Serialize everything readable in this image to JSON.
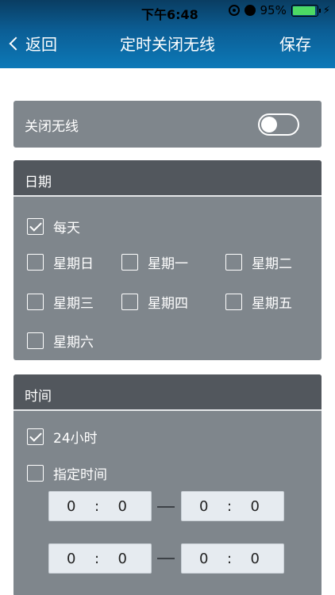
{
  "status": {
    "time": "下午6:48",
    "battery": "95%",
    "battery_level": 0.95
  },
  "nav": {
    "back_label": "返回",
    "title": "定时关闭无线",
    "save_label": "保存"
  },
  "wifi": {
    "label": "关闭无线",
    "toggle_on": false
  },
  "date": {
    "header": "日期",
    "everyday": {
      "label": "每天",
      "checked": true
    },
    "days": [
      {
        "label": "星期日",
        "checked": false
      },
      {
        "label": "星期一",
        "checked": false
      },
      {
        "label": "星期二",
        "checked": false
      },
      {
        "label": "星期三",
        "checked": false
      },
      {
        "label": "星期四",
        "checked": false
      },
      {
        "label": "星期五",
        "checked": false
      },
      {
        "label": "星期六",
        "checked": false
      }
    ]
  },
  "time": {
    "header": "时间",
    "full_day": {
      "label": "24小时",
      "checked": true
    },
    "specified": {
      "label": "指定时间",
      "checked": false
    },
    "ranges": [
      {
        "start": {
          "hour": "0",
          "sep": ":",
          "minute": "0"
        },
        "end": {
          "hour": "0",
          "sep": ":",
          "minute": "0"
        }
      },
      {
        "start": {
          "hour": "0",
          "sep": ":",
          "minute": "0"
        },
        "end": {
          "hour": "0",
          "sep": ":",
          "minute": "0"
        }
      }
    ]
  },
  "colors": {
    "nav_bg": "#0b5e95",
    "card_bg": "#7f868c",
    "header_bg": "#52575d",
    "battery_fill": "#4cd964"
  }
}
